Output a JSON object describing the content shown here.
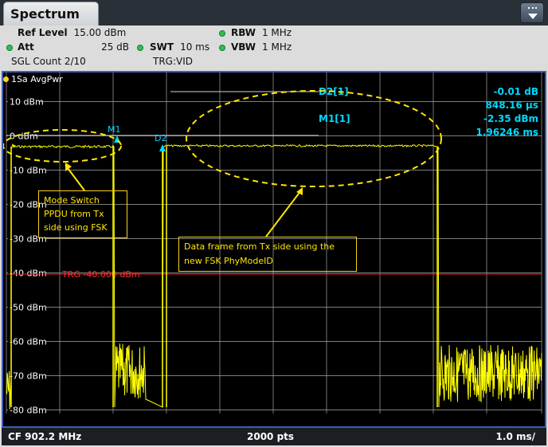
{
  "tab": {
    "title": "Spectrum"
  },
  "header": {
    "ref_level_label": "Ref Level",
    "ref_level_value": "15.00 dBm",
    "att_label": "Att",
    "att_value": "25 dB",
    "swt_label": "SWT",
    "swt_value": "10 ms",
    "rbw_label": "RBW",
    "rbw_value": "1 MHz",
    "vbw_label": "VBW",
    "vbw_value": "1 MHz",
    "sgl_count": "SGL Count 2/10",
    "trg": "TRG:VID"
  },
  "trace": {
    "label": "1Sa AvgPwr",
    "color": "#ffff00"
  },
  "y_labels": [
    "10 dBm",
    "0 dBm",
    "-10 dBm",
    "-20 dBm",
    "-30 dBm",
    "-40 dBm",
    "-50 dBm",
    "-60 dBm",
    "-70 dBm",
    "-80 dBm"
  ],
  "trigger": {
    "label": "TRG  -40.000 dBm",
    "color": "#ff2020"
  },
  "markers": {
    "m1": "M1",
    "d2": "D2",
    "d2_label": "D2[1]",
    "m1_label": "M1[1]",
    "d2_value": "-0.01 dB",
    "d2_time": "848.16 µs",
    "m1_value": "-2.35 dBm",
    "m1_time": "1.96246 ms",
    "color": "#00d8ff"
  },
  "annotations": {
    "left_note": "Mode Switch PPDU from Tx side using FSK",
    "right_note": "Data frame from Tx side using the new FSK PhyModeID"
  },
  "footer": {
    "cf": "CF 902.2 MHz",
    "points": "2000 pts",
    "scale": "1.0 ms/"
  }
}
